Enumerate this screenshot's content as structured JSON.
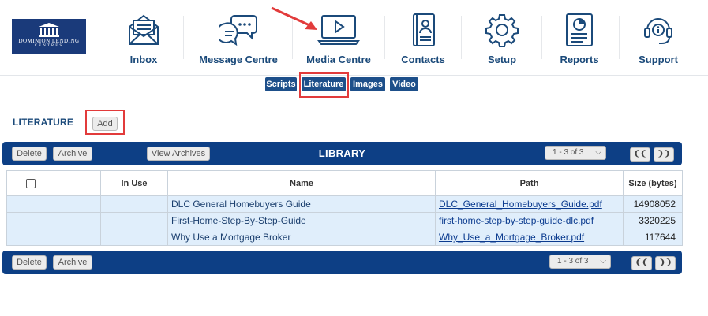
{
  "logo": {
    "line1": "DOMINION LENDING",
    "line2": "CENTRES"
  },
  "nav": [
    {
      "label": "Inbox",
      "icon": "inbox-icon"
    },
    {
      "label": "Message Centre",
      "icon": "message-bubbles-icon"
    },
    {
      "label": "Media Centre",
      "icon": "play-monitor-icon"
    },
    {
      "label": "Contacts",
      "icon": "contacts-book-icon"
    },
    {
      "label": "Setup",
      "icon": "gear-icon"
    },
    {
      "label": "Reports",
      "icon": "report-icon"
    },
    {
      "label": "Support",
      "icon": "headset-icon"
    }
  ],
  "subtabs": [
    "Scripts",
    "Literature",
    "Images",
    "Video"
  ],
  "active_subtab": "Literature",
  "section_title": "LITERATURE",
  "add_label": "Add",
  "toolbar": {
    "delete_label": "Delete",
    "archive_label": "Archive",
    "view_archives_label": "View Archives",
    "title": "LIBRARY",
    "pager_text": "1 - 3 of 3",
    "prev_label": "❨❨",
    "next_label": "❩❩"
  },
  "table": {
    "headers": [
      "",
      "",
      "In Use",
      "Name",
      "Path",
      "Size (bytes)"
    ],
    "rows": [
      {
        "name": "DLC General Homebuyers Guide",
        "path": "DLC_General_Homebuyers_Guide.pdf",
        "size": "14908052"
      },
      {
        "name": "First-Home-Step-By-Step-Guide",
        "path": "first-home-step-by-step-guide-dlc.pdf",
        "size": "3320225"
      },
      {
        "name": "Why Use a Mortgage Broker",
        "path": "Why_Use_a_Mortgage_Broker.pdf",
        "size": "117644"
      }
    ]
  },
  "colors": {
    "brand": "#0d3f85",
    "highlight": "#e23b3b",
    "row_bg": "#e0eefb"
  }
}
